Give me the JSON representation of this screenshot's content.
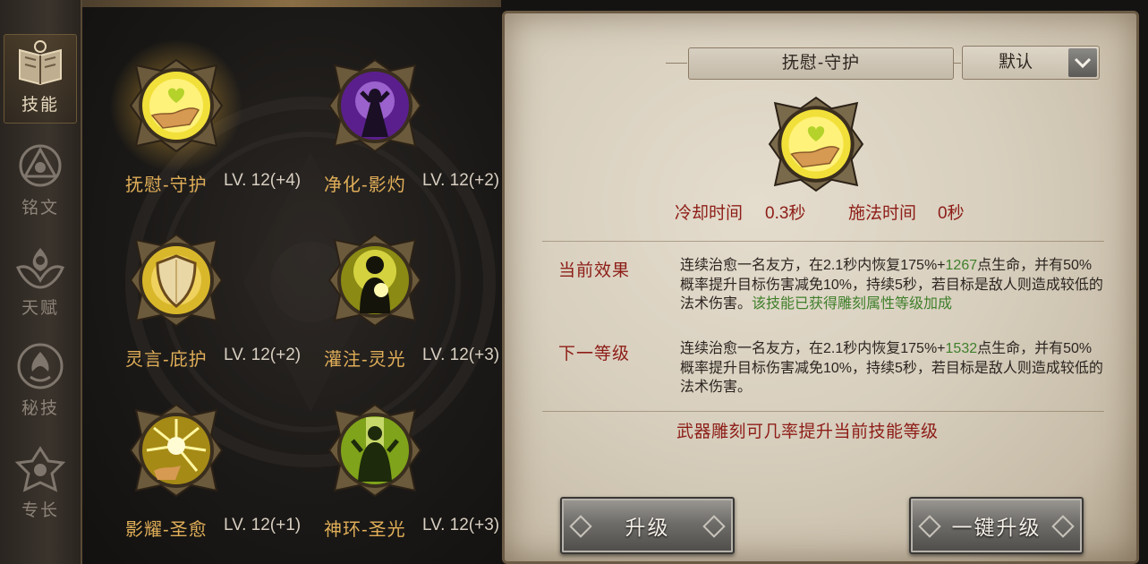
{
  "nav": {
    "items": [
      {
        "label": "技能",
        "icon": "skill-book-icon",
        "active": true
      },
      {
        "label": "铭文",
        "icon": "inscription-icon",
        "active": false
      },
      {
        "label": "天赋",
        "icon": "talent-icon",
        "active": false
      },
      {
        "label": "秘技",
        "icon": "secret-skill-icon",
        "active": false
      },
      {
        "label": "专长",
        "icon": "specialty-icon",
        "active": false
      }
    ]
  },
  "skills": [
    {
      "name": "抚慰-守护",
      "level": "LV. 12(+4)",
      "icon": "healing-hand-icon",
      "selected": true
    },
    {
      "name": "净化-影灼",
      "level": "LV. 12(+2)",
      "icon": "purify-shadow-icon",
      "selected": false
    },
    {
      "name": "灵言-庇护",
      "level": "LV. 12(+2)",
      "icon": "shield-icon",
      "selected": false
    },
    {
      "name": "灌注-灵光",
      "level": "LV. 12(+3)",
      "icon": "infusion-light-icon",
      "selected": false
    },
    {
      "name": "影耀-圣愈",
      "level": "LV. 12(+1)",
      "icon": "radiant-burst-icon",
      "selected": false
    },
    {
      "name": "神环-圣光",
      "level": "LV. 12(+3)",
      "icon": "holy-halo-icon",
      "selected": false
    }
  ],
  "detail": {
    "title": "抚慰-守护",
    "dropdown_value": "默认",
    "cooldown_label": "冷却时间",
    "cooldown_value": "0.3秒",
    "cast_label": "施法时间",
    "cast_value": "0秒",
    "current_label": "当前效果",
    "current_text_a": "连续治愈一名友方，在2.1秒内恢复175%+",
    "current_heal": "1267",
    "current_text_b": "点生命，并有50%概率提升目标伤害减免10%，持续5秒，若目标是敌人则造成较低的法术伤害。",
    "current_bonus": "该技能已获得雕刻属性等级加成",
    "next_label": "下一等级",
    "next_text_a": "连续治愈一名友方，在2.1秒内恢复175%+",
    "next_heal": "1532",
    "next_text_b": "点生命，并有50%概率提升目标伤害减免10%，持续5秒，若目标是敌人则造成较低的法术伤害。",
    "tip": "武器雕刻可几率提升当前技能等级",
    "upgrade_label": "升级",
    "upgrade_all_label": "一键升级"
  },
  "colors": {
    "skill_name": "#e0ae58",
    "red_label": "#8d1d17",
    "green_value": "#3f7f2b",
    "parchment": "#d8cfbe"
  }
}
